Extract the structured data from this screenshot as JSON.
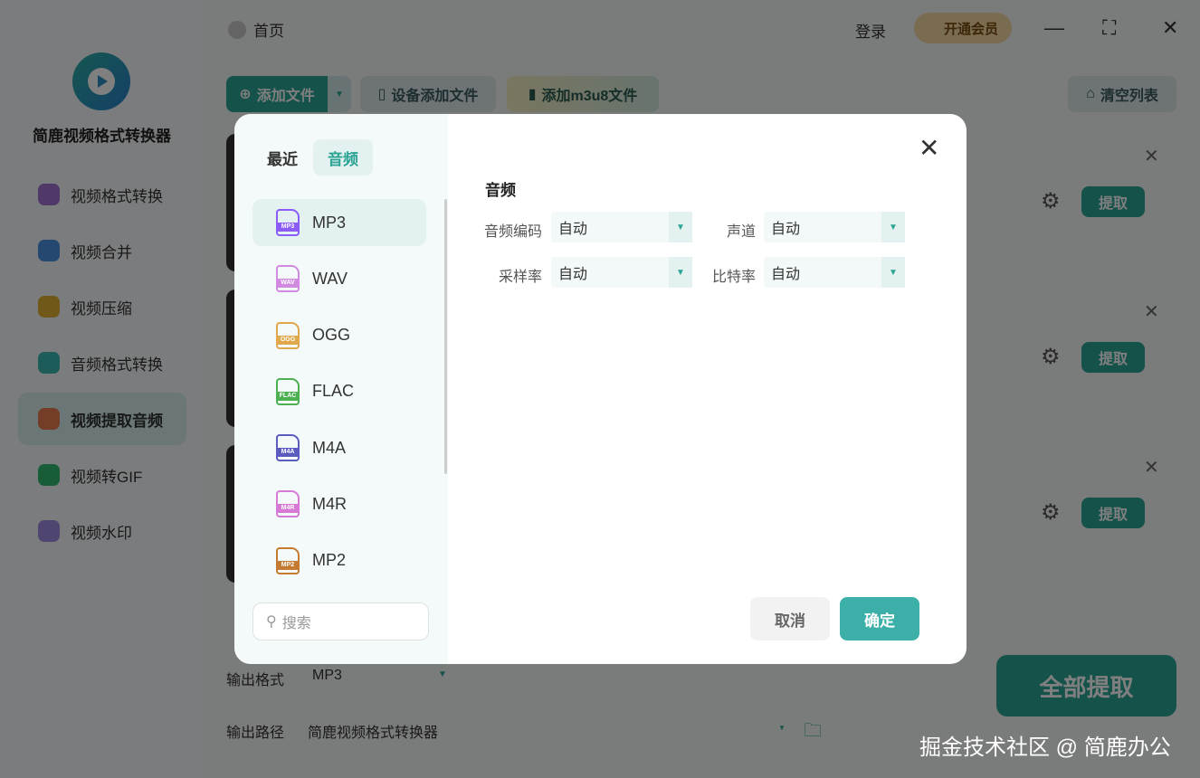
{
  "app": {
    "name": "简鹿视频格式转换器",
    "home": "首页",
    "login": "登录",
    "vip": "开通会员",
    "minimize": "—",
    "maximize": "⛶",
    "close": "✕"
  },
  "sidebar": {
    "items": [
      {
        "label": "视频格式转换",
        "color": "#a070d0"
      },
      {
        "label": "视频合并",
        "color": "#4a90e2"
      },
      {
        "label": "视频压缩",
        "color": "#e0b030"
      },
      {
        "label": "音频格式转换",
        "color": "#3bb8b0"
      },
      {
        "label": "视频提取音频",
        "color": "#e87a50",
        "active": true
      },
      {
        "label": "视频转GIF",
        "color": "#30b870"
      },
      {
        "label": "视频水印",
        "color": "#a08ae0"
      }
    ]
  },
  "toolbar": {
    "add_file": "添加文件",
    "device_add": "设备添加文件",
    "add_m3u8": "添加m3u8文件",
    "clear": "清空列表"
  },
  "rows": [
    {
      "action": "提取"
    },
    {
      "action": "提取"
    },
    {
      "action": "提取"
    }
  ],
  "bottom": {
    "format_label": "输出格式",
    "format_value": "MP3",
    "path_label": "输出路径",
    "path_value": "简鹿视频格式转换器",
    "extract_all": "全部提取"
  },
  "watermark": "掘金技术社区 @ 简鹿办公",
  "modal": {
    "tabs": [
      {
        "label": "最近"
      },
      {
        "label": "音频",
        "active": true
      }
    ],
    "formats": [
      {
        "name": "MP3",
        "color": "#8b5cf6",
        "active": true
      },
      {
        "name": "WAV",
        "color": "#d08ae0"
      },
      {
        "name": "OGG",
        "color": "#e0a84a"
      },
      {
        "name": "FLAC",
        "color": "#4caf50"
      },
      {
        "name": "M4A",
        "color": "#5c5cc0"
      },
      {
        "name": "M4R",
        "color": "#d67ad6"
      },
      {
        "name": "MP2",
        "color": "#c47a30"
      }
    ],
    "search_placeholder": "搜索",
    "section_title": "音频",
    "fields": {
      "codec": {
        "label": "音频编码",
        "value": "自动"
      },
      "channel": {
        "label": "声道",
        "value": "自动"
      },
      "sample_rate": {
        "label": "采样率",
        "value": "自动"
      },
      "bitrate": {
        "label": "比特率",
        "value": "自动"
      }
    },
    "cancel": "取消",
    "ok": "确定"
  }
}
